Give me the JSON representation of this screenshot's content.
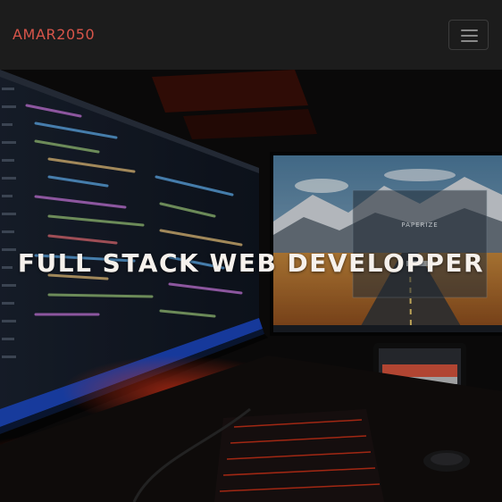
{
  "navbar": {
    "brand": "AMAR2050",
    "brand_color": "#d8554a",
    "menu_icon": "hamburger-menu-icon"
  },
  "hero": {
    "title": "FULL STACK WEB DEVELOPPER",
    "screen_label": "PAPERIZE",
    "background": "photo of a dark desk setup with code editor monitor, landscape wallpaper monitor, phone and red-lit keyboard"
  }
}
